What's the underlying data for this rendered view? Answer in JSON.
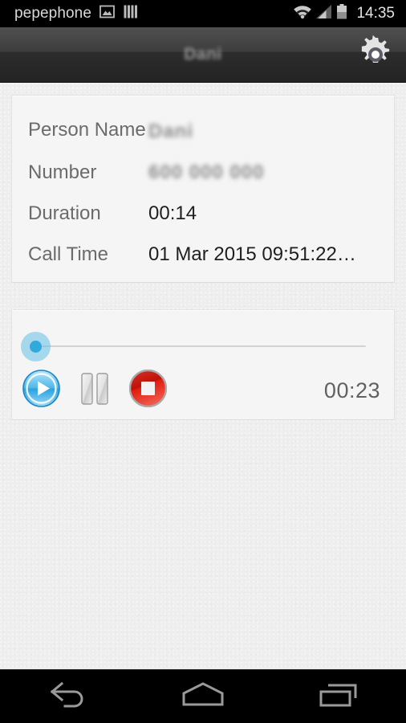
{
  "status_bar": {
    "carrier": "pepephone",
    "clock": "14:35",
    "icons_left": [
      "picture-icon",
      "barcode-icon"
    ],
    "icons_right": [
      "wifi-icon",
      "signal-icon",
      "battery-icon"
    ]
  },
  "action_bar": {
    "title": "Dani",
    "title_redacted": true,
    "settings_icon": "gear-icon"
  },
  "info_card": {
    "rows": [
      {
        "label": "Person Name",
        "value": "Dani",
        "redacted": true
      },
      {
        "label": "Number",
        "value": "600 000 000",
        "redacted": true
      },
      {
        "label": "Duration",
        "value": "00:14",
        "redacted": false
      },
      {
        "label": "Call Time",
        "value": "01 Mar 2015 09:51:22…",
        "redacted": false
      }
    ]
  },
  "player": {
    "seek": {
      "value_percent": 0,
      "thumb_icon": "seek-thumb"
    },
    "buttons": [
      {
        "name": "play-button",
        "icon": "play-icon",
        "label": "Play"
      },
      {
        "name": "pause-button",
        "icon": "pause-icon",
        "label": "Pause"
      },
      {
        "name": "stop-button",
        "icon": "stop-icon",
        "label": "Stop"
      }
    ],
    "elapsed": "00:23"
  },
  "nav_bar": {
    "buttons": [
      {
        "name": "back-button",
        "icon": "back-arrow-icon"
      },
      {
        "name": "home-button",
        "icon": "home-icon"
      },
      {
        "name": "recents-button",
        "icon": "recents-icon"
      }
    ]
  },
  "colors": {
    "accent_blue": "#33a8dd",
    "stop_red": "#d8261c",
    "background": "#eeeeee",
    "card": "#f5f5f5",
    "action_bar": "#2c2c2c"
  }
}
